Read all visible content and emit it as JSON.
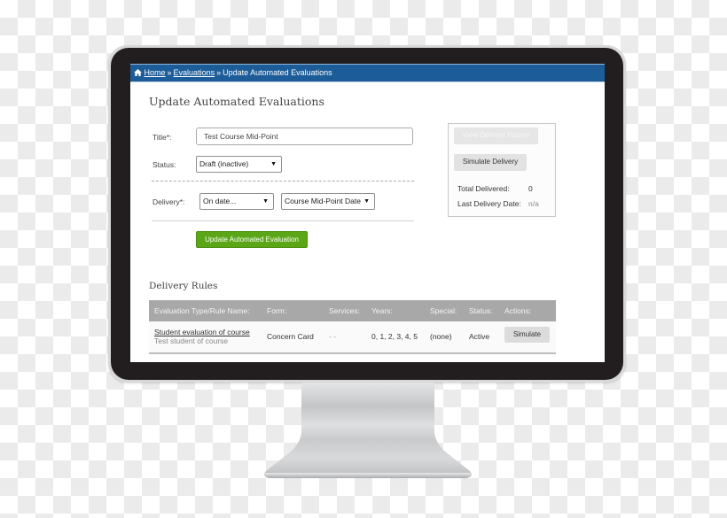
{
  "breadcrumb": {
    "home_icon": "home-icon",
    "items": [
      "Home",
      "Evaluations",
      "Update Automated Evaluations"
    ],
    "separator": "»"
  },
  "page": {
    "title": "Update Automated Evaluations"
  },
  "form": {
    "title_label": "Title*:",
    "title_value": "Test Course Mid-Point",
    "status_label": "Status:",
    "status_value": "Draft (inactive)",
    "delivery_label": "Delivery*:",
    "delivery_when_value": "On date...",
    "delivery_date_value": "Course Mid-Point Date",
    "submit_label": "Update Automated Evaluation",
    "caret": "▼"
  },
  "side_panel": {
    "view_history_label": "View Delivery History",
    "simulate_label": "Simulate Delivery",
    "total_delivered_label": "Total Delivered:",
    "total_delivered_value": "0",
    "last_delivery_label": "Last Delivery Date:",
    "last_delivery_value": "n/a"
  },
  "delivery_rules": {
    "title": "Delivery Rules",
    "columns": [
      "Evaluation Type/Rule Name:",
      "Form:",
      "Services:",
      "Years:",
      "Special:",
      "Status:",
      "Actions:"
    ],
    "rows": [
      {
        "rule_name": "Student evaluation of course",
        "rule_sub": "Test student of course",
        "form": "Concern Card",
        "services": "- -",
        "years": "0, 1, 2, 3, 4, 5",
        "special": "(none)",
        "status": "Active",
        "action_label": "Simulate"
      }
    ]
  },
  "colors": {
    "header_blue": "#1c5c99",
    "button_green": "#5aa617",
    "table_header_gray": "#a8a8a8",
    "bezel": "#221e1f"
  }
}
